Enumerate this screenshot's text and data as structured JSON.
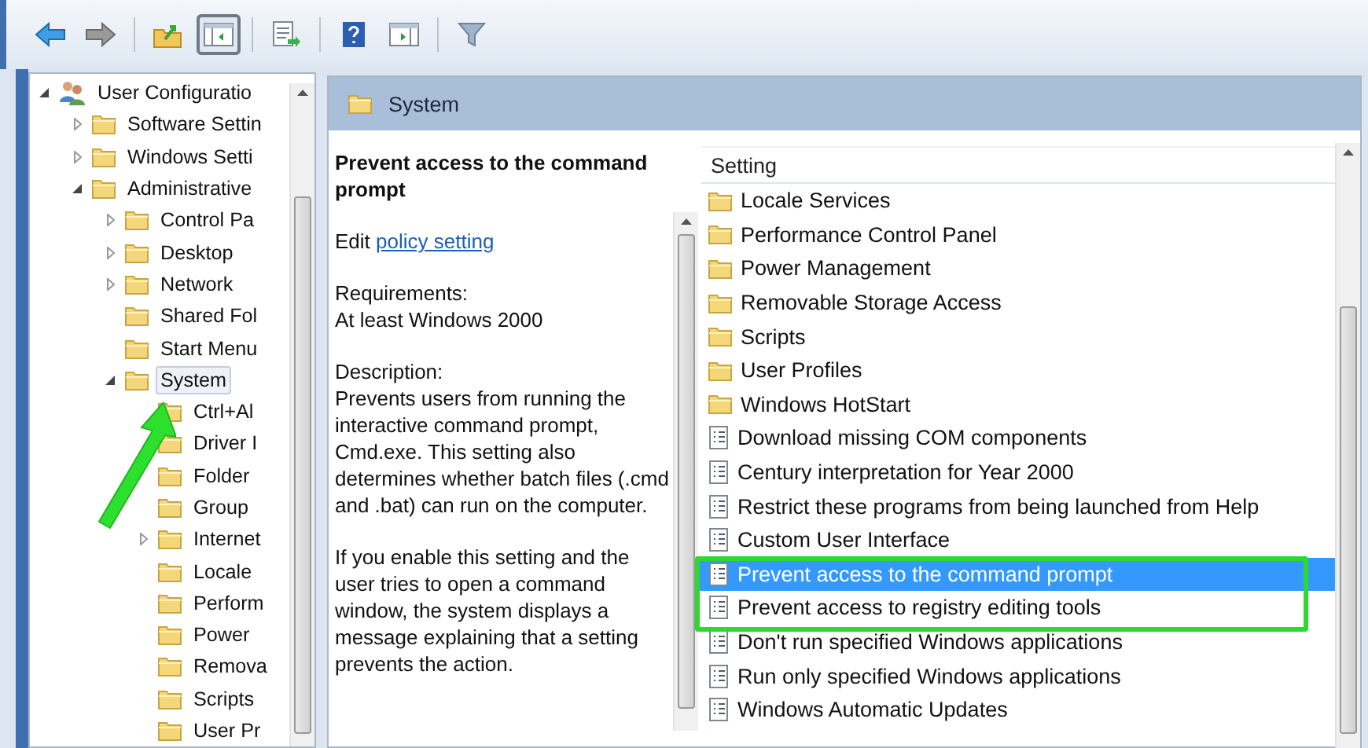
{
  "toolbar": [
    {
      "kind": "back",
      "pressed": false
    },
    {
      "kind": "forward",
      "pressed": false
    },
    {
      "kind": "sep"
    },
    {
      "kind": "up",
      "pressed": false
    },
    {
      "kind": "tree",
      "pressed": true
    },
    {
      "kind": "sep"
    },
    {
      "kind": "export",
      "pressed": false
    },
    {
      "kind": "sep"
    },
    {
      "kind": "help",
      "pressed": false
    },
    {
      "kind": "view",
      "pressed": false
    },
    {
      "kind": "sep"
    },
    {
      "kind": "filter",
      "pressed": false
    }
  ],
  "tree": [
    {
      "label": "User Configuratio",
      "kind": "user",
      "expanded": true,
      "selected": false,
      "children": [
        {
          "label": "Software Settin",
          "kind": "folder",
          "expanded": false,
          "selected": false
        },
        {
          "label": "Windows Setti",
          "kind": "folder",
          "expanded": false,
          "selected": false
        },
        {
          "label": "Administrative",
          "kind": "folder",
          "expanded": true,
          "selected": false,
          "children": [
            {
              "label": "Control Pa",
              "kind": "folder",
              "expanded": false,
              "selected": false
            },
            {
              "label": "Desktop",
              "kind": "folder",
              "expanded": false,
              "selected": false
            },
            {
              "label": "Network",
              "kind": "folder",
              "expanded": false,
              "selected": false
            },
            {
              "label": "Shared Fol",
              "kind": "folder",
              "selected": false
            },
            {
              "label": "Start Menu",
              "kind": "folder",
              "selected": false
            },
            {
              "label": "System",
              "kind": "folder",
              "expanded": true,
              "selected": true,
              "children": [
                {
                  "label": "Ctrl+Al",
                  "kind": "folder",
                  "selected": false
                },
                {
                  "label": "Driver I",
                  "kind": "folder",
                  "selected": false
                },
                {
                  "label": "Folder",
                  "kind": "folder",
                  "selected": false
                },
                {
                  "label": "Group",
                  "kind": "folder",
                  "selected": false
                },
                {
                  "label": "Internet",
                  "kind": "folder",
                  "expanded": false,
                  "selected": false
                },
                {
                  "label": "Locale",
                  "kind": "folder",
                  "selected": false
                },
                {
                  "label": "Perform",
                  "kind": "folder",
                  "selected": false
                },
                {
                  "label": "Power",
                  "kind": "folder",
                  "selected": false
                },
                {
                  "label": "Remova",
                  "kind": "folder",
                  "selected": false
                },
                {
                  "label": "Scripts",
                  "kind": "folder",
                  "selected": false
                },
                {
                  "label": "User Pr",
                  "kind": "folder",
                  "selected": false
                }
              ]
            }
          ]
        }
      ]
    }
  ],
  "panel": {
    "title": "System"
  },
  "detail": {
    "heading": "Prevent access to the command prompt",
    "edit_prefix": "Edit",
    "edit_link": "policy setting",
    "requirements_label": "Requirements:",
    "requirements": "At least Windows 2000",
    "description_label": "Description:",
    "paragraphs": [
      "Prevents users from running the interactive command prompt, Cmd.exe. This setting also determines whether batch files (.cmd and .bat) can run on the computer.",
      "If you enable this setting and the user tries to open a command window, the system displays a message explaining that a setting prevents the action."
    ]
  },
  "list": {
    "column": "Setting",
    "rows": [
      {
        "label": "Locale Services",
        "kind": "folder",
        "selected": false
      },
      {
        "label": "Performance Control Panel",
        "kind": "folder",
        "selected": false
      },
      {
        "label": "Power Management",
        "kind": "folder",
        "selected": false
      },
      {
        "label": "Removable Storage Access",
        "kind": "folder",
        "selected": false
      },
      {
        "label": "Scripts",
        "kind": "folder",
        "selected": false
      },
      {
        "label": "User Profiles",
        "kind": "folder",
        "selected": false
      },
      {
        "label": "Windows HotStart",
        "kind": "folder",
        "selected": false
      },
      {
        "label": "Download missing COM components",
        "kind": "policy",
        "selected": false
      },
      {
        "label": "Century interpretation for Year 2000",
        "kind": "policy",
        "selected": false
      },
      {
        "label": "Restrict these programs from being launched from Help",
        "kind": "policy",
        "selected": false
      },
      {
        "label": "Custom User Interface",
        "kind": "policy",
        "selected": false
      },
      {
        "label": "Prevent access to the command prompt",
        "kind": "policy",
        "selected": true
      },
      {
        "label": "Prevent access to registry editing tools",
        "kind": "policy",
        "selected": false
      },
      {
        "label": "Don't run specified Windows applications",
        "kind": "policy",
        "selected": false
      },
      {
        "label": "Run only specified Windows applications",
        "kind": "policy",
        "selected": false
      },
      {
        "label": "Windows Automatic Updates",
        "kind": "policy",
        "selected": false
      }
    ]
  }
}
